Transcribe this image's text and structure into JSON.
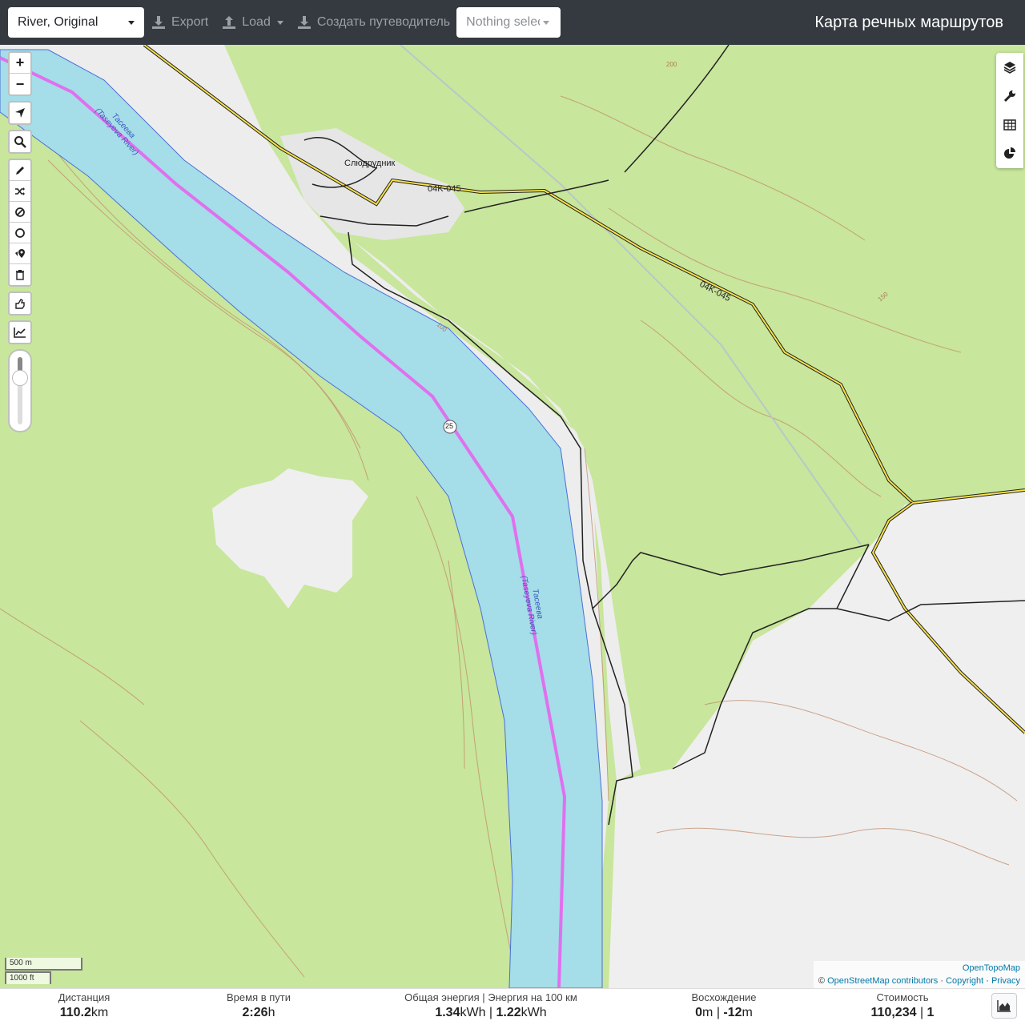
{
  "navbar": {
    "profile": "River, Original",
    "export_label": "Export",
    "load_label": "Load",
    "guide_label": "Создать путеводитель",
    "nothing_selected": "Nothing selected",
    "brand": "Карта речных маршрутов"
  },
  "map": {
    "labels": {
      "village": "Слюдрудник",
      "road_code_1": "04K-045",
      "road_code_2": "04K-045",
      "river_name_1": "Тасеева",
      "river_name_1_en": "(Taseyeva River)",
      "river_name_2": "Тасеева",
      "river_name_2_en": "(Taseyeva River)",
      "route_marker": "25",
      "contour_100": "100",
      "contour_150": "150",
      "contour_200": "200"
    },
    "scale": {
      "metric": "500 m",
      "imperial": "1000 ft"
    },
    "attribution": {
      "provider": "OpenTopoMap",
      "copyright_symbol": "©",
      "osm": "OpenStreetMap contributors",
      "separator": "·",
      "copyright": "Copyright",
      "privacy": "Privacy"
    },
    "colors": {
      "forest": "#c8e69c",
      "open": "#f0f0f0",
      "river": "#a5dde8",
      "route": "#e070ee",
      "road": "#f6e04b",
      "contour": "#c08a6a"
    }
  },
  "controls": {
    "zoom_in": "+",
    "zoom_out": "−",
    "left_icons": [
      "locate-icon",
      "search-icon",
      "draw-icon",
      "shuffle-icon",
      "block-icon",
      "circle-icon",
      "poi-icon",
      "trash-icon",
      "hand-icon",
      "chart-line-icon"
    ],
    "right_icons": [
      "layers-icon",
      "wrench-icon",
      "table-icon",
      "pie-chart-icon"
    ]
  },
  "stats": {
    "distance": {
      "label": "Дистанция",
      "value": "110.2",
      "unit": "km"
    },
    "time": {
      "label": "Время в пути",
      "value": "2:26",
      "unit": "h"
    },
    "energy": {
      "label": "Общая энергия | Энергия на 100 км",
      "value1": "1.34",
      "unit1": "kWh",
      "sep": "|",
      "value2": "1.22",
      "unit2": "kWh"
    },
    "ascent": {
      "label": "Восхождение",
      "value1": "0",
      "unit1": "m",
      "sep": "|",
      "value2": "-12",
      "unit2": "m"
    },
    "cost": {
      "label": "Стоимость",
      "value1": "110,234",
      "sep": "|",
      "value2": "1"
    }
  }
}
